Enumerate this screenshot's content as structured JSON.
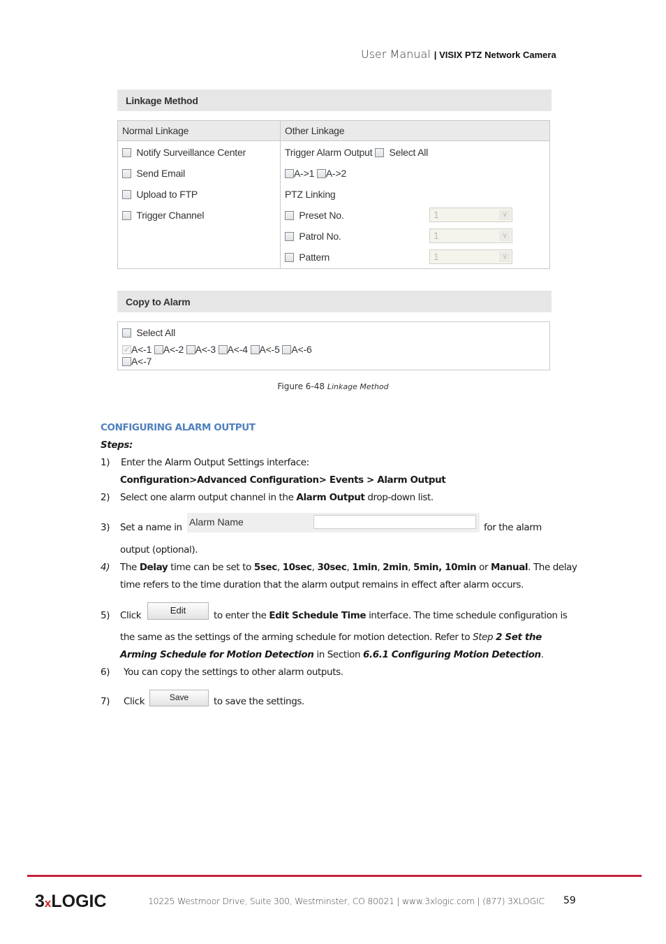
{
  "header": {
    "title": "User Manual",
    "separator": "|",
    "product": "VISIX PTZ Network Camera"
  },
  "linkage": {
    "section_title": "Linkage Method",
    "normal": {
      "title": "Normal Linkage",
      "items": [
        {
          "label": "Notify Surveillance Center",
          "checked": false
        },
        {
          "label": "Send Email",
          "checked": false
        },
        {
          "label": "Upload to FTP",
          "checked": false
        },
        {
          "label": "Trigger Channel",
          "checked": false
        }
      ]
    },
    "other": {
      "title": "Other Linkage",
      "trigger_alarm_output": "Trigger Alarm Output",
      "select_all": "Select All",
      "outputs": [
        {
          "label": "A->1",
          "checked": false
        },
        {
          "label": "A->2",
          "checked": false
        }
      ],
      "ptz_title": "PTZ Linking",
      "ptz": [
        {
          "label": "Preset No.",
          "value": "1"
        },
        {
          "label": "Patrol No.",
          "value": "1"
        },
        {
          "label": "Pattern",
          "value": "1"
        }
      ]
    }
  },
  "copy": {
    "section_title": "Copy to Alarm",
    "select_all": "Select All",
    "alarms": [
      {
        "label": "A<-1",
        "checked": true
      },
      {
        "label": "A<-2",
        "checked": false
      },
      {
        "label": "A<-3",
        "checked": false
      },
      {
        "label": "A<-4",
        "checked": false
      },
      {
        "label": "A<-5",
        "checked": false
      },
      {
        "label": "A<-6",
        "checked": false
      },
      {
        "label": "A<-7",
        "checked": false
      }
    ]
  },
  "figure": {
    "number": "Figure 6-48",
    "caption": "Linkage Method"
  },
  "section": {
    "heading": "CONFIGURING ALARM OUTPUT",
    "steps_label": "Steps:",
    "step1": {
      "n": "1)",
      "text": "Enter the Alarm Output Settings interface:",
      "path": "Configuration>Advanced Configuration> Events > Alarm Output"
    },
    "step2": {
      "n": "2)",
      "pre": "Select one alarm output channel in the ",
      "bold": "Alarm Output",
      "post": " drop-down list."
    },
    "step3": {
      "n": "3)",
      "pre": "Set a name in",
      "field_label": "Alarm Name",
      "field_value": "",
      "post": "for the alarm",
      "cont": "output (optional)."
    },
    "step4": {
      "n": "4)",
      "parts": [
        "The ",
        "Delay",
        " time can be set to ",
        "5sec",
        ", ",
        "10sec",
        ", ",
        "30sec",
        ", ",
        "1min",
        ", ",
        "2min",
        ", ",
        "5min, 10min",
        " or ",
        "Manual",
        ". The delay"
      ],
      "cont": "time refers to the time duration that the alarm output remains in effect after alarm occurs."
    },
    "step5": {
      "n": "5)",
      "pre": "Click",
      "button": "Edit",
      "post1": "to enter the ",
      "bold": "Edit Schedule Time",
      "post2": " interface. The time schedule configuration is",
      "line2_pre": "the same as the settings of the arming schedule for motion detection. Refer to ",
      "line2_i": "Step ",
      "line2_bi": "2 Set the",
      "line3_bi": "Arming Schedule for Motion Detection",
      "line3_mid": " in Section ",
      "line3_bi2": "6.6.1 Configuring Motion Detection",
      "line3_end": "."
    },
    "step6": {
      "n": "6)",
      "text": "You can copy the settings to other alarm outputs."
    },
    "step7": {
      "n": "7)",
      "pre": "Click",
      "button": "Save",
      "post": "to save the settings."
    }
  },
  "footer": {
    "logo_3": "3",
    "logo_x": "x",
    "logo_rest": "LOGIC",
    "address": "10225 Westmoor Drive, Suite 300, Westminster, CO 80021 | www.3xlogic.com | (877) 3XLOGIC",
    "page": "59",
    "accent": "#c8203a"
  }
}
